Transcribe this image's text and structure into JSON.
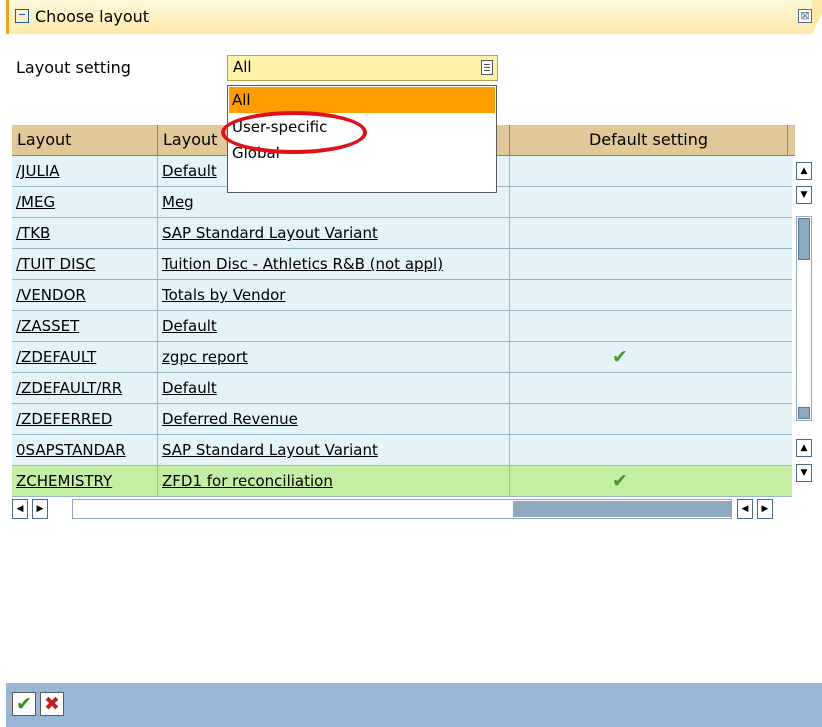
{
  "window": {
    "title": "Choose layout",
    "close_symbol": "⊠"
  },
  "layout_setting": {
    "label": "Layout setting",
    "value": "All",
    "options": [
      "All",
      "User-specific",
      "Global"
    ]
  },
  "table": {
    "columns": [
      "Layout",
      "Layout",
      "Default setting"
    ],
    "rows": [
      {
        "layout": "/JULIA",
        "description": "Default",
        "default": false
      },
      {
        "layout": "/MEG",
        "description": "Meg",
        "default": false
      },
      {
        "layout": "/TKB",
        "description": "SAP Standard Layout Variant",
        "default": false
      },
      {
        "layout": "/TUIT DISC",
        "description": "Tuition Disc - Athletics R&B (not appl)",
        "default": false
      },
      {
        "layout": "/VENDOR",
        "description": "Totals by Vendor",
        "default": false
      },
      {
        "layout": "/ZASSET",
        "description": "Default",
        "default": false
      },
      {
        "layout": "/ZDEFAULT",
        "description": "zgpc report",
        "default": true
      },
      {
        "layout": "/ZDEFAULT/RR",
        "description": "Default",
        "default": false
      },
      {
        "layout": "/ZDEFERRED",
        "description": "Deferred Revenue",
        "default": false
      },
      {
        "layout": "0SAPSTANDAR",
        "description": "SAP Standard Layout Variant",
        "default": false
      },
      {
        "layout": "ZCHEMISTRY",
        "description": "ZFD1 for reconciliation",
        "default": true,
        "selected": true
      }
    ]
  },
  "footer": {
    "confirm_symbol": "✔",
    "cancel_symbol": "✖"
  },
  "colors": {
    "title_accent": "#f0a020",
    "selected_row": "#c4eea4",
    "highlight_option": "#ff9c00",
    "annotation_circle": "#e0101a",
    "footer_bar": "#9ab6d6"
  }
}
